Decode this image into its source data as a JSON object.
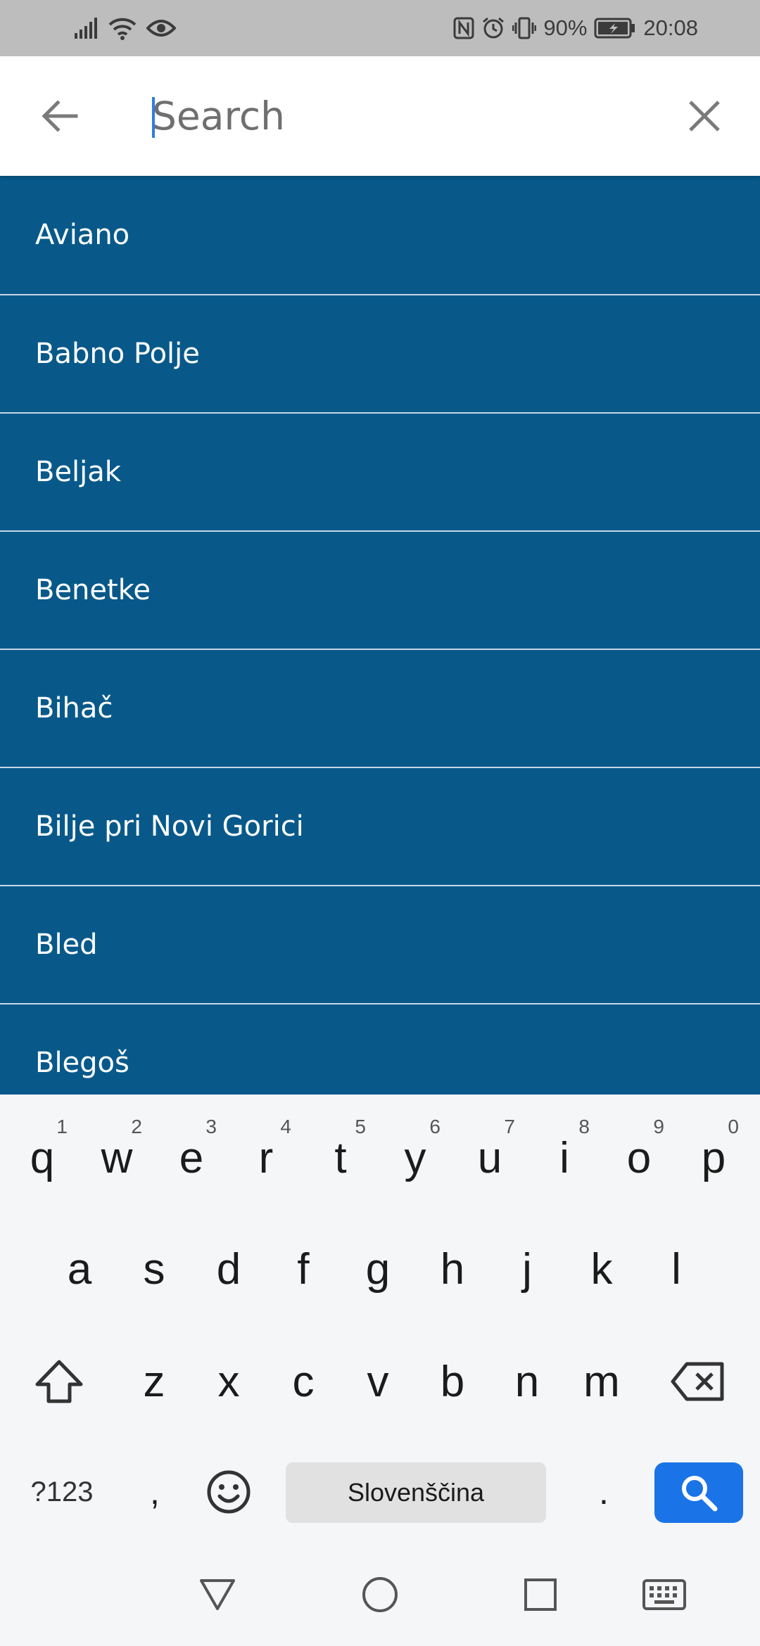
{
  "status_bar": {
    "battery": "90%",
    "time": "20:08",
    "icons_left": [
      "signal-icon",
      "wifi-icon",
      "eye-icon"
    ],
    "icons_right": [
      "nfc-icon",
      "alarm-icon",
      "vibrate-icon",
      "battery-charging-icon"
    ]
  },
  "search": {
    "placeholder": "Search",
    "value": ""
  },
  "results": [
    "Aviano",
    "Babno Polje",
    "Beljak",
    "Benetke",
    "Bihač",
    "Bilje pri Novi Gorici",
    "Bled",
    "Blegoš"
  ],
  "keyboard": {
    "row1": [
      {
        "ch": "q",
        "hint": "1"
      },
      {
        "ch": "w",
        "hint": "2"
      },
      {
        "ch": "e",
        "hint": "3"
      },
      {
        "ch": "r",
        "hint": "4"
      },
      {
        "ch": "t",
        "hint": "5"
      },
      {
        "ch": "y",
        "hint": "6"
      },
      {
        "ch": "u",
        "hint": "7"
      },
      {
        "ch": "i",
        "hint": "8"
      },
      {
        "ch": "o",
        "hint": "9"
      },
      {
        "ch": "p",
        "hint": "0"
      }
    ],
    "row2": [
      "a",
      "s",
      "d",
      "f",
      "g",
      "h",
      "j",
      "k",
      "l"
    ],
    "row3": [
      "z",
      "x",
      "c",
      "v",
      "b",
      "n",
      "m"
    ],
    "symbols_label": "?123",
    "comma": ",",
    "space_label": "Slovenščina",
    "period": "."
  },
  "colors": {
    "list_background": "#08598a",
    "search_key": "#1b73e8",
    "status_bar": "#bdbdbd"
  }
}
